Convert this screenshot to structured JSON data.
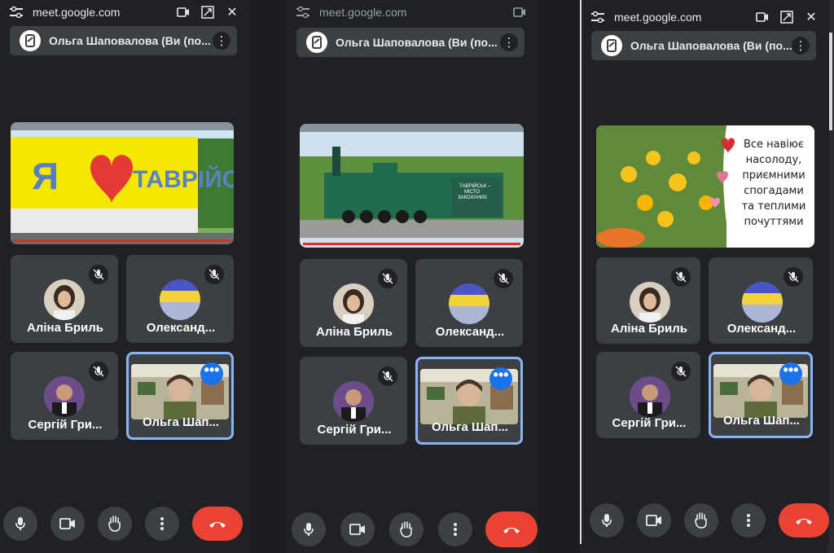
{
  "window": {
    "url": "meet.google.com"
  },
  "host": {
    "name": "Ольга Шаповалова (Ви (по..."
  },
  "panels": [
    {
      "host_name": "Ольга Шаповалова (Ви (по..."
    },
    {
      "host_name": "Ольга Шаповалова (Ви (по..."
    },
    {
      "host_name": "Ольга Шаповалова (Ви (по..."
    }
  ],
  "participants": [
    {
      "name": "Аліна Бриль",
      "muted": true
    },
    {
      "name": "Олександ...",
      "muted": true
    },
    {
      "name": "Сергій Гри...",
      "muted": true
    },
    {
      "name": "Ольга Шап...",
      "muted": false,
      "self": true
    }
  ],
  "shared_content": {
    "panel1_sign": {
      "letter_left": "Я",
      "word_right": "ТАВРІЙСЬК"
    },
    "panel2_plaque": "ТАВРІЙСЬК –\nМІСТО\nЗАКОХАНИХ",
    "panel3_quote": [
      "Все навіює",
      "насолоду,",
      "приємними",
      "спогадами",
      "та теплими",
      "почуттями"
    ]
  },
  "controls": [
    "mic-icon",
    "camera-icon",
    "raise-hand-icon",
    "more-options-icon",
    "end-call-icon"
  ],
  "colors": {
    "background": "#202124",
    "tile": "#3c4043",
    "active_border": "#8ab4f8",
    "end_call": "#ea4335",
    "more_badge": "#1a73e8"
  }
}
